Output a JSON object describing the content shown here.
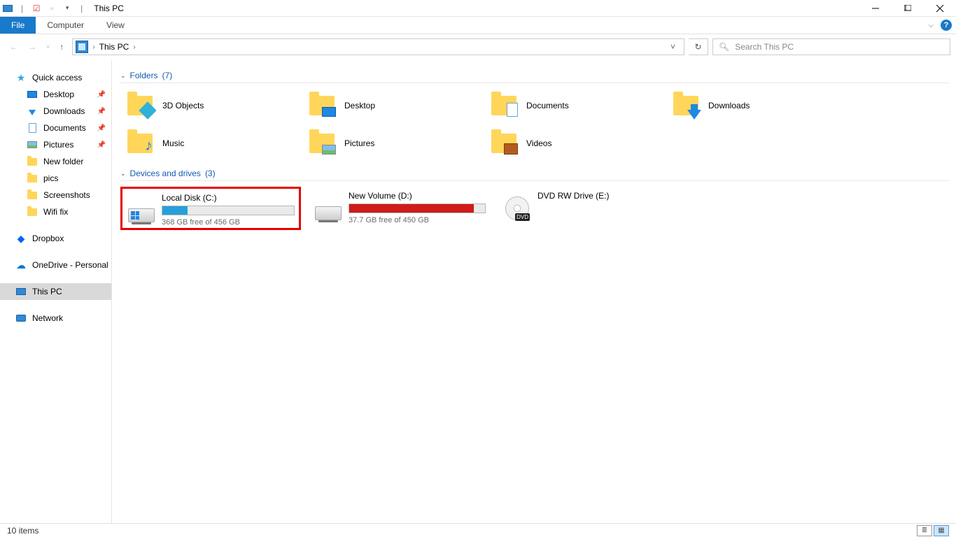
{
  "window": {
    "title": "This PC"
  },
  "ribbon": {
    "tabs": {
      "file": "File",
      "computer": "Computer",
      "view": "View"
    }
  },
  "address": {
    "crumb": "This PC",
    "search_placeholder": "Search This PC"
  },
  "sidebar": {
    "quick_access": "Quick access",
    "desktop": "Desktop",
    "downloads": "Downloads",
    "documents": "Documents",
    "pictures": "Pictures",
    "new_folder": "New folder",
    "pics": "pics",
    "screenshots": "Screenshots",
    "wifi_fix": "Wifi fix",
    "dropbox": "Dropbox",
    "onedrive": "OneDrive - Personal",
    "this_pc": "This PC",
    "network": "Network"
  },
  "groups": {
    "folders": {
      "label": "Folders",
      "count": "(7)"
    },
    "drives": {
      "label": "Devices and drives",
      "count": "(3)"
    }
  },
  "folders": {
    "objects3d": "3D Objects",
    "desktop": "Desktop",
    "documents": "Documents",
    "downloads": "Downloads",
    "music": "Music",
    "pictures": "Pictures",
    "videos": "Videos"
  },
  "drives": {
    "c": {
      "name": "Local Disk (C:)",
      "sub": "368 GB free of 456 GB",
      "fill_pct": 19,
      "fill_color": "#26a0da"
    },
    "d": {
      "name": "New Volume (D:)",
      "sub": "37.7 GB free of 450 GB",
      "fill_pct": 92,
      "fill_color": "#d11a1a"
    },
    "e": {
      "name": "DVD RW Drive (E:)"
    }
  },
  "status": {
    "items": "10 items"
  }
}
